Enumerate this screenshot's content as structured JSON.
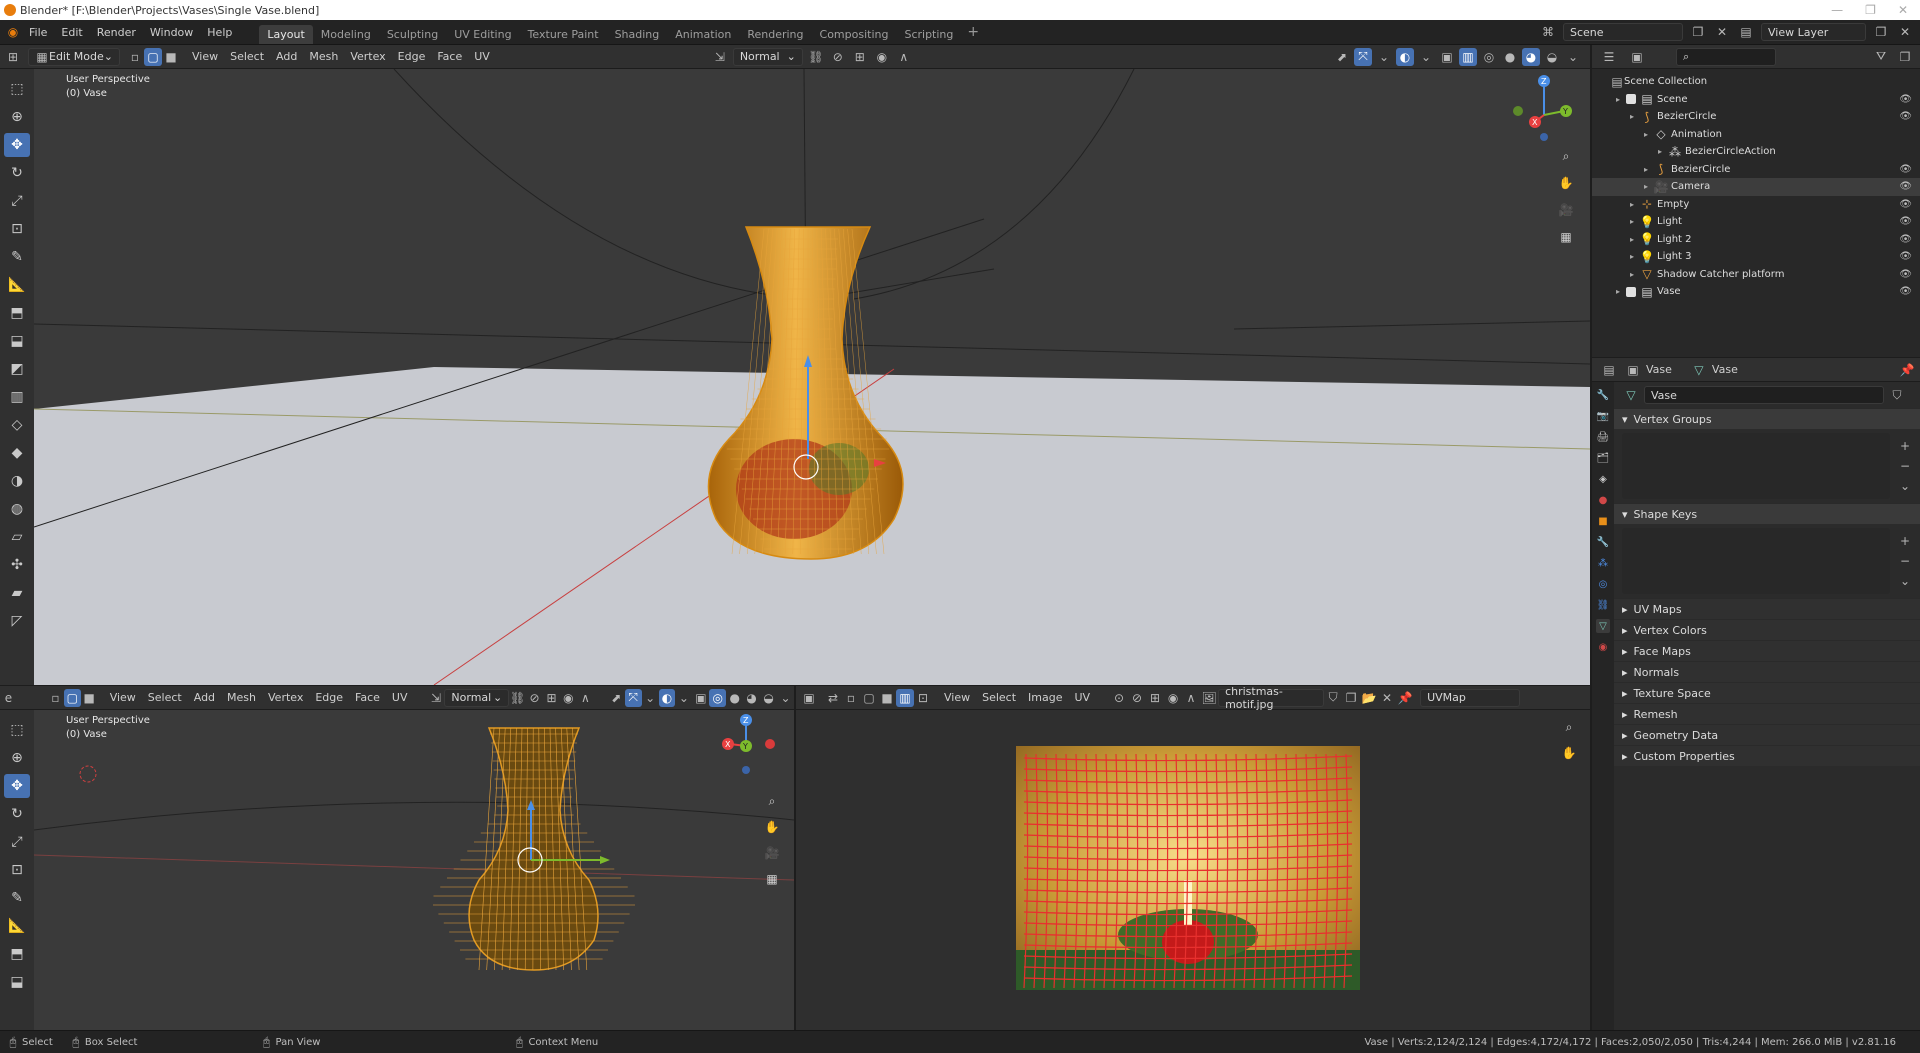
{
  "titlebar": {
    "title": "Blender* [F:\\Blender\\Projects\\Vases\\Single Vase.blend]"
  },
  "topbar": {
    "menus": [
      "File",
      "Edit",
      "Render",
      "Window",
      "Help"
    ],
    "workspaces": [
      "Layout",
      "Modeling",
      "Sculpting",
      "UV Editing",
      "Texture Paint",
      "Shading",
      "Animation",
      "Rendering",
      "Compositing",
      "Scripting"
    ],
    "active_workspace": "Layout",
    "scene": "Scene",
    "view_layer": "View Layer"
  },
  "main_viewport": {
    "mode": "Edit Mode",
    "menus": [
      "View",
      "Select",
      "Add",
      "Mesh",
      "Vertex",
      "Edge",
      "Face",
      "UV"
    ],
    "orientation": "Normal",
    "perspective": "User Perspective",
    "object": "(0) Vase"
  },
  "lower_viewport": {
    "menus": [
      "View",
      "Select",
      "Add",
      "Mesh",
      "Vertex",
      "Edge",
      "Face",
      "UV"
    ],
    "orientation": "Normal",
    "perspective": "User Perspective",
    "object": "(0) Vase"
  },
  "uv_editor": {
    "menus": [
      "View",
      "Select",
      "Image",
      "UV"
    ],
    "image": "christmas-motif.jpg",
    "uvmap": "UVMap"
  },
  "outliner": {
    "root": "Scene Collection",
    "rows": [
      {
        "label": "Scene",
        "depth": 1,
        "icon": "collection-icon"
      },
      {
        "label": "BezierCircle",
        "depth": 2,
        "icon": "curve-icon"
      },
      {
        "label": "Animation",
        "depth": 3,
        "icon": "animation-icon"
      },
      {
        "label": "BezierCircleAction",
        "depth": 4,
        "icon": "action-icon"
      },
      {
        "label": "BezierCircle",
        "depth": 3,
        "icon": "curve-data-icon"
      },
      {
        "label": "Camera",
        "depth": 3,
        "icon": "camera-icon"
      },
      {
        "label": "Empty",
        "depth": 2,
        "icon": "empty-icon"
      },
      {
        "label": "Light",
        "depth": 2,
        "icon": "light-icon"
      },
      {
        "label": "Light 2",
        "depth": 2,
        "icon": "light-icon"
      },
      {
        "label": "Light 3",
        "depth": 2,
        "icon": "light-icon"
      },
      {
        "label": "Shadow Catcher platform",
        "depth": 2,
        "icon": "mesh-icon"
      },
      {
        "label": "Vase",
        "depth": 1,
        "icon": "collection-icon"
      }
    ]
  },
  "properties": {
    "breadcrumb_object": "Vase",
    "breadcrumb_data": "Vase",
    "data_name": "Vase",
    "panels_open": [
      "Vertex Groups",
      "Shape Keys"
    ],
    "panels_closed": [
      "UV Maps",
      "Vertex Colors",
      "Face Maps",
      "Normals",
      "Texture Space",
      "Remesh",
      "Geometry Data",
      "Custom Properties"
    ]
  },
  "statusbar": {
    "select": "Select",
    "box_select": "Box Select",
    "pan_view": "Pan View",
    "context_menu": "Context Menu",
    "stats": "Vase | Verts:2,124/2,124 | Edges:4,172/4,172 | Faces:2,050/2,050 | Tris:4,244 | Mem: 266.0 MiB | v2.81.16"
  },
  "colors": {
    "accent": "#4772b3",
    "vase": "#d9901c",
    "uv_wire": "#e8302e",
    "floor": "#c8cad0"
  }
}
